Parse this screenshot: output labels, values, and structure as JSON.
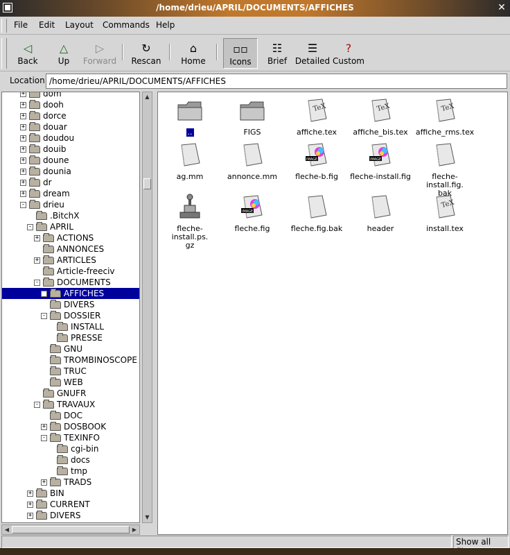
{
  "window": {
    "title": "/home/drieu/APRIL/DOCUMENTS/AFFICHES"
  },
  "menu": {
    "file": "File",
    "edit": "Edit",
    "layout": "Layout",
    "commands": "Commands",
    "help": "Help"
  },
  "toolbar": {
    "back": "Back",
    "up": "Up",
    "forward": "Forward",
    "rescan": "Rescan",
    "home": "Home",
    "icons": "Icons",
    "brief": "Brief",
    "detailed": "Detailed",
    "custom": "Custom"
  },
  "location": {
    "label": "Location:",
    "value": "/home/drieu/APRIL/DOCUMENTS/AFFICHES"
  },
  "tree": [
    {
      "label": "dom",
      "expander": "+"
    },
    {
      "label": "dooh",
      "expander": "+"
    },
    {
      "label": "dorce",
      "expander": "+"
    },
    {
      "label": "douar",
      "expander": "+"
    },
    {
      "label": "doudou",
      "expander": "+"
    },
    {
      "label": "douib",
      "expander": "+"
    },
    {
      "label": "doune",
      "expander": "+"
    },
    {
      "label": "dounia",
      "expander": "+"
    },
    {
      "label": "dr",
      "expander": "+"
    },
    {
      "label": "dream",
      "expander": "+"
    },
    {
      "label": "drieu",
      "expander": "-"
    },
    {
      "label": ".BitchX",
      "expander": ""
    },
    {
      "label": "APRIL",
      "expander": "-"
    },
    {
      "label": "ACTIONS",
      "expander": "+"
    },
    {
      "label": "ANNONCES",
      "expander": ""
    },
    {
      "label": "ARTICLES",
      "expander": "+"
    },
    {
      "label": "Article-freeciv",
      "expander": ""
    },
    {
      "label": "DOCUMENTS",
      "expander": "-"
    },
    {
      "label": "AFFICHES",
      "expander": "+",
      "selected": true
    },
    {
      "label": "DIVERS",
      "expander": ""
    },
    {
      "label": "DOSSIER",
      "expander": "-"
    },
    {
      "label": "INSTALL",
      "expander": ""
    },
    {
      "label": "PRESSE",
      "expander": ""
    },
    {
      "label": "GNU",
      "expander": ""
    },
    {
      "label": "TROMBINOSCOPE",
      "expander": ""
    },
    {
      "label": "TRUC",
      "expander": ""
    },
    {
      "label": "WEB",
      "expander": ""
    },
    {
      "label": "GNUFR",
      "expander": ""
    },
    {
      "label": "TRAVAUX",
      "expander": "-"
    },
    {
      "label": "DOC",
      "expander": ""
    },
    {
      "label": "DOSBOOK",
      "expander": "+"
    },
    {
      "label": "TEXINFO",
      "expander": "-"
    },
    {
      "label": "cgi-bin",
      "expander": ""
    },
    {
      "label": "docs",
      "expander": ""
    },
    {
      "label": "tmp",
      "expander": ""
    },
    {
      "label": "TRADS",
      "expander": "+"
    },
    {
      "label": "BIN",
      "expander": "+"
    },
    {
      "label": "CURRENT",
      "expander": "+"
    },
    {
      "label": "DIVERS",
      "expander": "+"
    }
  ],
  "files": [
    {
      "label": "..",
      "icon": "folder-icon",
      "selected": true
    },
    {
      "label": "FIGS",
      "icon": "folder-icon"
    },
    {
      "label": "affiche.tex",
      "icon": "tex-file-icon",
      "badge": "TeX"
    },
    {
      "label": "affiche_bis.tex",
      "icon": "tex-file-icon",
      "badge": "TeX"
    },
    {
      "label": "affiche_rms.tex",
      "icon": "tex-file-icon",
      "badge": "TeX"
    },
    {
      "label": "ag.mm",
      "icon": "document-icon"
    },
    {
      "label": "annonce.mm",
      "icon": "document-icon"
    },
    {
      "label": "fleche-b.fig",
      "icon": "image-file-icon",
      "badge": "IMAGE"
    },
    {
      "label": "fleche-install.fig",
      "icon": "image-file-icon",
      "badge": "IMAGE"
    },
    {
      "label": "fleche-install.fig.\nbak",
      "icon": "document-icon"
    },
    {
      "label": "fleche-install.ps.\ngz",
      "icon": "archive-press-icon"
    },
    {
      "label": "fleche.fig",
      "icon": "image-file-icon",
      "badge": "IMAGE"
    },
    {
      "label": "fleche.fig.bak",
      "icon": "document-icon"
    },
    {
      "label": "header",
      "icon": "document-icon"
    },
    {
      "label": "install.tex",
      "icon": "tex-file-icon",
      "badge": "TeX"
    }
  ],
  "status": {
    "left": "",
    "right": "Show all files"
  },
  "colors": {
    "selection": "#00009c",
    "title_accent": "#c0782c"
  }
}
